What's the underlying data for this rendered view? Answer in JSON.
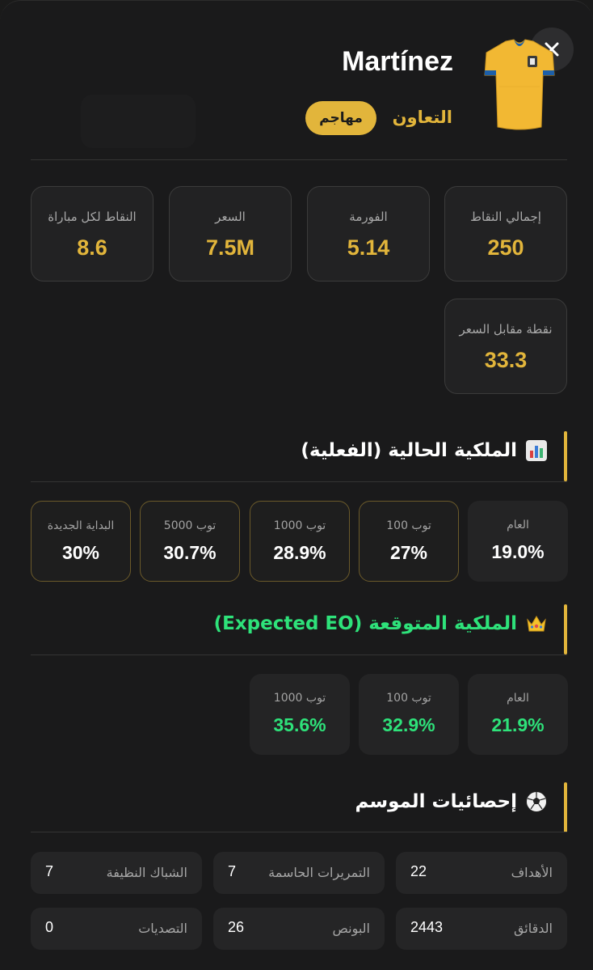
{
  "header": {
    "player_name": "Martínez",
    "team": "التعاون",
    "position": "مهاجم",
    "close_symbol": "×"
  },
  "stats": [
    {
      "label": "إجمالي النقاط",
      "value": "250"
    },
    {
      "label": "الفورمة",
      "value": "5.14"
    },
    {
      "label": "السعر",
      "value": "7.5M"
    },
    {
      "label": "النقاط لكل مباراة",
      "value": "8.6"
    },
    {
      "label": "نقطة مقابل السعر",
      "value": "33.3"
    }
  ],
  "current_ownership": {
    "title": "الملكية الحالية (الفعلية)",
    "icon": "bar-chart-icon",
    "items": [
      {
        "label": "العام",
        "value": "19.0%"
      },
      {
        "label": "توب 100",
        "value": "27%"
      },
      {
        "label": "توب 1000",
        "value": "28.9%"
      },
      {
        "label": "توب 5000",
        "value": "30.7%"
      },
      {
        "label": "البداية الجديدة",
        "value": "30%"
      }
    ]
  },
  "expected_ownership": {
    "title": "الملكية المتوقعة (Expected EO)",
    "icon": "crown-icon",
    "items": [
      {
        "label": "العام",
        "value": "21.9%"
      },
      {
        "label": "توب 100",
        "value": "32.9%"
      },
      {
        "label": "توب 1000",
        "value": "35.6%"
      }
    ]
  },
  "season_stats": {
    "title": "إحصائيات الموسم",
    "icon": "soccer-ball-icon",
    "items": [
      {
        "label": "الأهداف",
        "value": "22"
      },
      {
        "label": "التمريرات الحاسمة",
        "value": "7"
      },
      {
        "label": "الشباك النظيفة",
        "value": "7"
      },
      {
        "label": "الدقائق",
        "value": "2443"
      },
      {
        "label": "البونص",
        "value": "26"
      },
      {
        "label": "التصديات",
        "value": "0"
      }
    ]
  },
  "colors": {
    "accent": "#e2b53b",
    "green": "#2ee27a",
    "background": "#1a1a1b",
    "card": "#222223"
  }
}
